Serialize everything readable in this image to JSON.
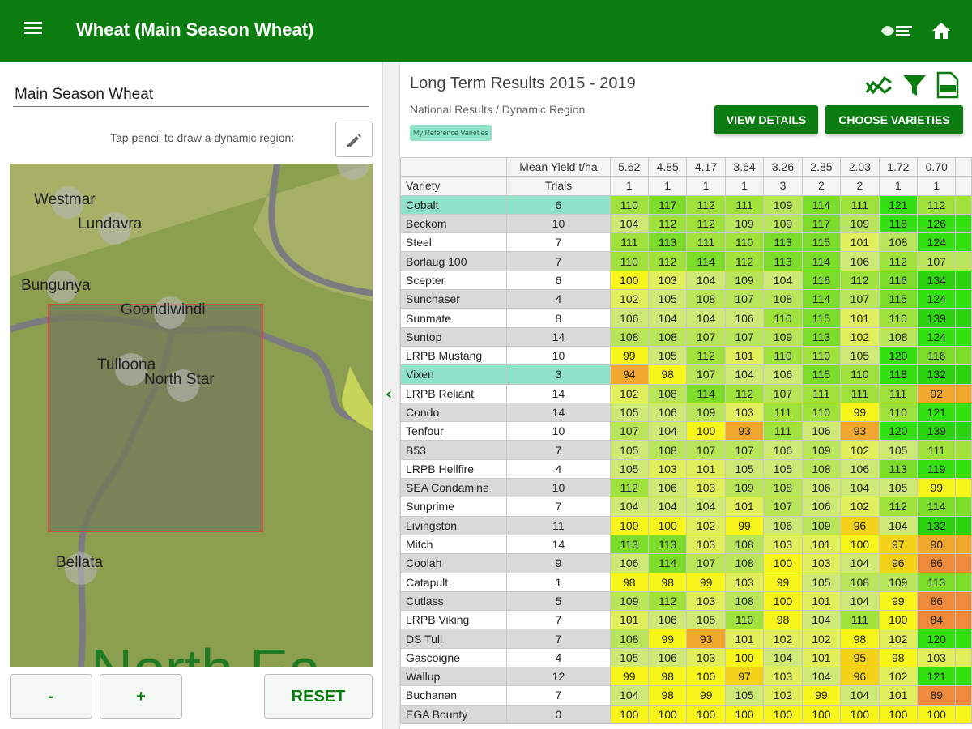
{
  "app": {
    "title": "Wheat (Main Season Wheat)"
  },
  "left": {
    "region_value": "Main Season Wheat",
    "hint": "Tap pencil to draw a dynamic region:",
    "map_labels": [
      "Westmar",
      "Lundavra",
      "Bungunya",
      "Goondiwindi",
      "Tulloona",
      "North Star",
      "Bellata",
      "North Ea"
    ],
    "buttons": {
      "minus": "-",
      "plus": "+",
      "reset": "RESET"
    }
  },
  "right": {
    "title": "Long Term Results 2015 - 2019",
    "subtitle": "National Results / Dynamic Region",
    "badge": "My Reference Varieties",
    "view_details": "VIEW DETAILS",
    "choose_varieties": "CHOOSE VARIETIES",
    "table": {
      "mean_yield_label": "Mean Yield t/ha",
      "variety_label": "Variety",
      "trials_label": "Trials",
      "mean_yields": [
        "5.62",
        "4.85",
        "4.17",
        "3.64",
        "3.26",
        "2.85",
        "2.03",
        "1.72",
        "0.70"
      ],
      "trial_counts": [
        "1",
        "1",
        "1",
        "1",
        "3",
        "2",
        "2",
        "1",
        "1"
      ],
      "rows": [
        {
          "variety": "Cobalt",
          "trials": "6",
          "ref": true,
          "values": [
            110,
            117,
            112,
            111,
            109,
            114,
            111,
            121,
            112
          ]
        },
        {
          "variety": "Beckom",
          "trials": "10",
          "values": [
            104,
            112,
            112,
            109,
            109,
            117,
            109,
            118,
            126
          ]
        },
        {
          "variety": "Steel",
          "trials": "7",
          "values": [
            111,
            113,
            111,
            110,
            113,
            115,
            101,
            108,
            124
          ]
        },
        {
          "variety": "Borlaug 100",
          "trials": "7",
          "values": [
            110,
            112,
            114,
            112,
            113,
            114,
            106,
            112,
            107
          ]
        },
        {
          "variety": "Scepter",
          "trials": "6",
          "values": [
            100,
            103,
            104,
            109,
            104,
            116,
            112,
            116,
            134
          ]
        },
        {
          "variety": "Sunchaser",
          "trials": "4",
          "values": [
            102,
            105,
            108,
            107,
            108,
            114,
            107,
            115,
            124
          ]
        },
        {
          "variety": "Sunmate",
          "trials": "8",
          "values": [
            106,
            104,
            104,
            106,
            110,
            115,
            101,
            110,
            139
          ]
        },
        {
          "variety": "Suntop",
          "trials": "14",
          "values": [
            108,
            108,
            107,
            107,
            109,
            113,
            102,
            108,
            124
          ]
        },
        {
          "variety": "LRPB Mustang",
          "trials": "10",
          "values": [
            99,
            105,
            112,
            101,
            110,
            110,
            105,
            120,
            116
          ]
        },
        {
          "variety": "Vixen",
          "trials": "3",
          "ref": true,
          "values": [
            94,
            98,
            107,
            104,
            106,
            115,
            110,
            118,
            132
          ]
        },
        {
          "variety": "LRPB Reliant",
          "trials": "14",
          "values": [
            102,
            108,
            114,
            112,
            107,
            111,
            111,
            111,
            92
          ]
        },
        {
          "variety": "Condo",
          "trials": "14",
          "values": [
            105,
            106,
            109,
            103,
            111,
            110,
            99,
            110,
            121
          ]
        },
        {
          "variety": "Tenfour",
          "trials": "10",
          "values": [
            107,
            104,
            100,
            93,
            111,
            106,
            93,
            120,
            139
          ]
        },
        {
          "variety": "B53",
          "trials": "7",
          "values": [
            105,
            108,
            107,
            107,
            106,
            109,
            102,
            105,
            111
          ]
        },
        {
          "variety": "LRPB Hellfire",
          "trials": "4",
          "values": [
            105,
            103,
            101,
            105,
            105,
            108,
            106,
            113,
            119
          ]
        },
        {
          "variety": "SEA Condamine",
          "trials": "10",
          "values": [
            112,
            106,
            103,
            109,
            108,
            106,
            104,
            105,
            99
          ]
        },
        {
          "variety": "Sunprime",
          "trials": "7",
          "values": [
            104,
            104,
            104,
            101,
            107,
            106,
            102,
            112,
            114
          ]
        },
        {
          "variety": "Livingston",
          "trials": "11",
          "values": [
            100,
            100,
            102,
            99,
            106,
            109,
            96,
            104,
            132
          ]
        },
        {
          "variety": "Mitch",
          "trials": "14",
          "values": [
            113,
            113,
            103,
            108,
            103,
            101,
            100,
            97,
            90
          ]
        },
        {
          "variety": "Coolah",
          "trials": "9",
          "values": [
            106,
            114,
            107,
            108,
            100,
            103,
            104,
            96,
            86
          ]
        },
        {
          "variety": "Catapult",
          "trials": "1",
          "values": [
            98,
            98,
            99,
            103,
            99,
            105,
            108,
            109,
            113
          ]
        },
        {
          "variety": "Cutlass",
          "trials": "5",
          "values": [
            109,
            112,
            103,
            108,
            100,
            101,
            104,
            99,
            86
          ]
        },
        {
          "variety": "LRPB Viking",
          "trials": "7",
          "values": [
            101,
            106,
            105,
            110,
            98,
            104,
            111,
            100,
            84
          ]
        },
        {
          "variety": "DS Tull",
          "trials": "7",
          "values": [
            108,
            99,
            93,
            101,
            102,
            102,
            98,
            102,
            120
          ]
        },
        {
          "variety": "Gascoigne",
          "trials": "4",
          "values": [
            105,
            106,
            103,
            100,
            104,
            101,
            95,
            98,
            103
          ]
        },
        {
          "variety": "Wallup",
          "trials": "12",
          "values": [
            99,
            98,
            100,
            97,
            103,
            104,
            96,
            102,
            121
          ]
        },
        {
          "variety": "Buchanan",
          "trials": "7",
          "values": [
            104,
            98,
            99,
            105,
            102,
            99,
            104,
            101,
            89
          ]
        },
        {
          "variety": "EGA Bounty",
          "trials": "0",
          "values": [
            100,
            100,
            100,
            100,
            100,
            100,
            100,
            100,
            100
          ]
        }
      ]
    }
  },
  "colors": {
    "brand_green": "#0b7d10",
    "reference_row": "#8ee3c8",
    "map_land": "#8c9e4f",
    "map_region_border": "#e0343a"
  }
}
